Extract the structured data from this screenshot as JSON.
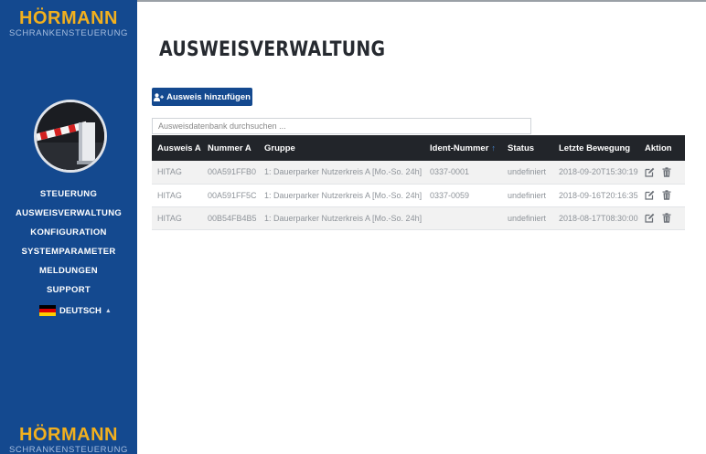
{
  "brand": {
    "name": "HÖRMANN",
    "subtitle": "SCHRANKENSTEUERUNG"
  },
  "nav": {
    "items": [
      {
        "label": "STEUERUNG"
      },
      {
        "label": "AUSWEISVERWALTUNG"
      },
      {
        "label": "KONFIGURATION"
      },
      {
        "label": "SYSTEMPARAMETER"
      },
      {
        "label": "MELDUNGEN"
      },
      {
        "label": "SUPPORT"
      }
    ]
  },
  "language": {
    "label": "DEUTSCH",
    "caret": "▲",
    "flag_colors": [
      "#000000",
      "#dd0000",
      "#ffce00"
    ]
  },
  "page": {
    "title": "AUSWEISVERWALTUNG"
  },
  "toolbar": {
    "add_label": "Ausweis hinzufügen"
  },
  "search": {
    "placeholder": "Ausweisdatenbank durchsuchen ..."
  },
  "table": {
    "columns": [
      "Ausweis A",
      "Nummer A",
      "Gruppe",
      "Ident-Nummer",
      "Status",
      "Letzte Bewegung",
      "Aktion"
    ],
    "sort_column": "Ident-Nummer",
    "sort_icon": "sort-up-icon",
    "rows": [
      {
        "ausweis": "HITAG",
        "nummer": "00A591FFB0",
        "gruppe": "1: Dauerparker Nutzerkreis A [Mo.-So. 24h]",
        "ident": "0337-0001",
        "status": "undefiniert",
        "bewegung": "2018-09-20T15:30:19"
      },
      {
        "ausweis": "HITAG",
        "nummer": "00A591FF5C",
        "gruppe": "1: Dauerparker Nutzerkreis A [Mo.-So. 24h]",
        "ident": "0337-0059",
        "status": "undefiniert",
        "bewegung": "2018-09-16T20:16:35"
      },
      {
        "ausweis": "HITAG",
        "nummer": "00B54FB4B5",
        "gruppe": "1: Dauerparker Nutzerkreis A [Mo.-So. 24h]",
        "ident": "",
        "status": "undefiniert",
        "bewegung": "2018-08-17T08:30:00"
      }
    ]
  },
  "colors": {
    "sidebar": "#14498f",
    "brand_accent": "#f2b01e",
    "table_header": "#22252a",
    "sort_arrow": "#4a90e2"
  }
}
